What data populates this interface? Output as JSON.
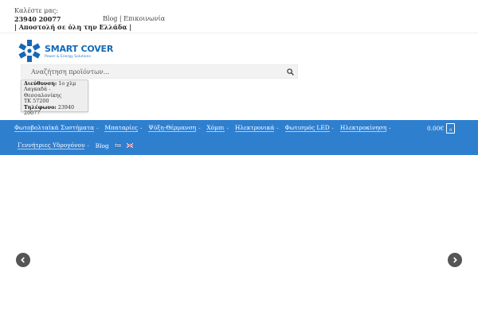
{
  "topbar": {
    "call_label": "Καλέστε μας:",
    "phone": "23940 20077",
    "shipping": "| Αποστολή σε όλη την Ελλάδα |",
    "links": [
      "Blog",
      "Επικοινωνία"
    ],
    "link_separator": " | "
  },
  "logo": {
    "name": "SMART COVER",
    "tagline": "Power & Energy Solutions",
    "brand_color": "#1569b7"
  },
  "search": {
    "placeholder": "Αναζήτηση προϊόντων...",
    "icon": "search-icon"
  },
  "address": {
    "address_label": "Διεύθυνση:",
    "address_line1": "1ο χλμ",
    "address_line2": "Λαγκαδά - Θεσσαλονίκης",
    "address_line3": "ΤΚ 57200",
    "phone_label": "Τηλέφωνο:",
    "phone_part1": "23940",
    "phone_part2": "20077"
  },
  "nav": {
    "bg_color": "#2f7fcf",
    "row1": [
      {
        "label": "Φωτοβολταϊκά Συστήματα",
        "has_dropdown": true
      },
      {
        "label": "Μπαταρίες",
        "has_dropdown": true
      },
      {
        "label": "Ψύξη-Θέρμανση",
        "has_dropdown": true
      },
      {
        "label": "Χόμπι",
        "has_dropdown": true
      },
      {
        "label": "Ηλεκτρονικά",
        "has_dropdown": true
      },
      {
        "label": "Φωτισμός LED",
        "has_dropdown": true
      },
      {
        "label": "Ηλεκτροκίνηση",
        "has_dropdown": true
      }
    ],
    "row2": [
      {
        "label": "Γεννήτριες Υδρογόνου",
        "has_dropdown": true
      },
      {
        "label": "Blog",
        "has_dropdown": false
      }
    ],
    "languages": [
      "greek-flag",
      "uk-flag"
    ]
  },
  "cart": {
    "total": "0.00€",
    "count": "0"
  },
  "slider": {
    "prev_icon": "chevron-left-icon",
    "next_icon": "chevron-right-icon"
  }
}
